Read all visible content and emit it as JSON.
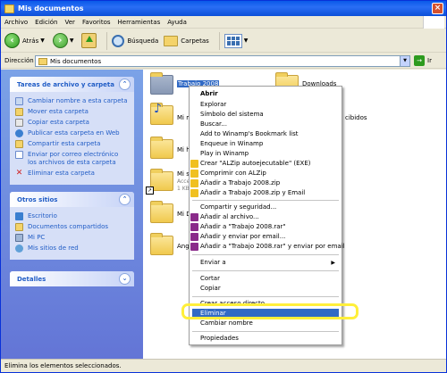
{
  "window": {
    "title": "Mis documentos"
  },
  "menubar": [
    "Archivo",
    "Edición",
    "Ver",
    "Favoritos",
    "Herramientas",
    "Ayuda"
  ],
  "toolbar": {
    "back": "Atrás",
    "search": "Búsqueda",
    "folders": "Carpetas"
  },
  "address": {
    "label": "Dirección",
    "value": "Mis documentos",
    "go": "Ir"
  },
  "tasks": {
    "title": "Tareas de archivo y carpeta",
    "items": [
      "Cambiar nombre a esta carpeta",
      "Mover esta carpeta",
      "Copiar esta carpeta",
      "Publicar esta carpeta en Web",
      "Compartir esta carpeta",
      "Enviar por correo electrónico los archivos de esta carpeta",
      "Eliminar esta carpeta"
    ]
  },
  "other_places": {
    "title": "Otros sitios",
    "items": [
      "Escritorio",
      "Documentos compartidos",
      "Mi PC",
      "Mis sitios de red"
    ]
  },
  "details": {
    "title": "Detalles"
  },
  "files": {
    "trabajo": "Trabajo 2008",
    "downloads": "Downloads",
    "mimusic": "Mi m",
    "recibidos": "cibidos",
    "mih": "Mi h",
    "misc": "Mi s",
    "misc_sub1": "Acce",
    "misc_sub2": "1 KB",
    "mid": "Mi D",
    "ange": "Ange"
  },
  "context_menu": {
    "group1": [
      "Abrir",
      "Explorar",
      "Símbolo del sistema",
      "Buscar...",
      "Add to Winamp's Bookmark list",
      "Enqueue in Winamp",
      "Play in Winamp",
      "Crear \"ALZip autoejecutable\" (EXE)",
      "Comprimir con ALZip",
      "Añadir a Trabajo 2008.zip",
      "Añadir a Trabajo 2008.zip y Email"
    ],
    "group2": [
      "Compartir y seguridad...",
      "Añadir al archivo...",
      "Añadir a \"Trabajo 2008.rar\"",
      "Añadir y enviar por email...",
      "Añadir a \"Trabajo 2008.rar\" y enviar por email"
    ],
    "send_to": "Enviar a",
    "group3": [
      "Cortar",
      "Copiar"
    ],
    "group4": [
      "Crear acceso directo",
      "Eliminar",
      "Cambiar nombre"
    ],
    "properties": "Propiedades"
  },
  "status": "Elimina los elementos seleccionados.",
  "colors": {
    "selection": "#316ac5",
    "highlight_ring": "#ffef3a",
    "link": "#215dc6"
  }
}
